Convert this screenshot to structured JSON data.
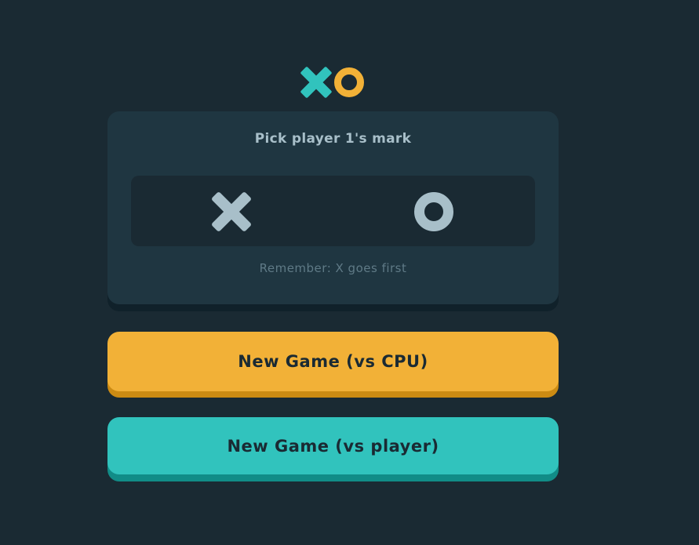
{
  "logo": {
    "icon": "xo-logo",
    "x_color": "#31c3bd",
    "o_color": "#f2b137"
  },
  "picker": {
    "title": "Pick player 1's mark",
    "options": [
      {
        "mark": "X",
        "icon": "x-mark-icon"
      },
      {
        "mark": "O",
        "icon": "o-mark-icon"
      }
    ],
    "hint": "Remember: X goes first",
    "mark_color": "#a8bfc9"
  },
  "buttons": {
    "vs_cpu": "New Game (vs CPU)",
    "vs_player": "New Game (vs player)"
  },
  "colors": {
    "background": "#1a2a33",
    "panel": "#1f3641",
    "yellow": "#f2b137",
    "teal": "#31c3bd",
    "silver": "#a8bfc9"
  }
}
